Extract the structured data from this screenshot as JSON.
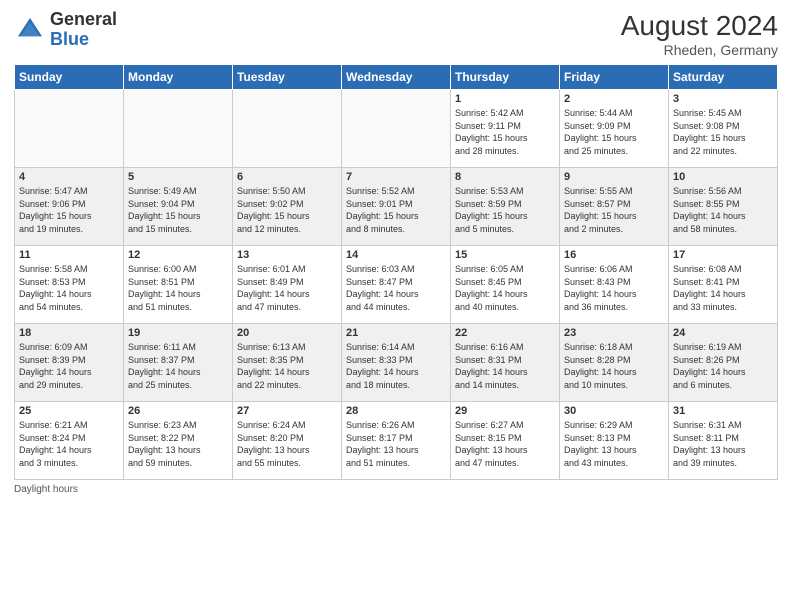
{
  "header": {
    "logo_general": "General",
    "logo_blue": "Blue",
    "month_year": "August 2024",
    "location": "Rheden, Germany"
  },
  "days_of_week": [
    "Sunday",
    "Monday",
    "Tuesday",
    "Wednesday",
    "Thursday",
    "Friday",
    "Saturday"
  ],
  "weeks": [
    [
      {
        "day": "",
        "info": ""
      },
      {
        "day": "",
        "info": ""
      },
      {
        "day": "",
        "info": ""
      },
      {
        "day": "",
        "info": ""
      },
      {
        "day": "1",
        "info": "Sunrise: 5:42 AM\nSunset: 9:11 PM\nDaylight: 15 hours\nand 28 minutes."
      },
      {
        "day": "2",
        "info": "Sunrise: 5:44 AM\nSunset: 9:09 PM\nDaylight: 15 hours\nand 25 minutes."
      },
      {
        "day": "3",
        "info": "Sunrise: 5:45 AM\nSunset: 9:08 PM\nDaylight: 15 hours\nand 22 minutes."
      }
    ],
    [
      {
        "day": "4",
        "info": "Sunrise: 5:47 AM\nSunset: 9:06 PM\nDaylight: 15 hours\nand 19 minutes."
      },
      {
        "day": "5",
        "info": "Sunrise: 5:49 AM\nSunset: 9:04 PM\nDaylight: 15 hours\nand 15 minutes."
      },
      {
        "day": "6",
        "info": "Sunrise: 5:50 AM\nSunset: 9:02 PM\nDaylight: 15 hours\nand 12 minutes."
      },
      {
        "day": "7",
        "info": "Sunrise: 5:52 AM\nSunset: 9:01 PM\nDaylight: 15 hours\nand 8 minutes."
      },
      {
        "day": "8",
        "info": "Sunrise: 5:53 AM\nSunset: 8:59 PM\nDaylight: 15 hours\nand 5 minutes."
      },
      {
        "day": "9",
        "info": "Sunrise: 5:55 AM\nSunset: 8:57 PM\nDaylight: 15 hours\nand 2 minutes."
      },
      {
        "day": "10",
        "info": "Sunrise: 5:56 AM\nSunset: 8:55 PM\nDaylight: 14 hours\nand 58 minutes."
      }
    ],
    [
      {
        "day": "11",
        "info": "Sunrise: 5:58 AM\nSunset: 8:53 PM\nDaylight: 14 hours\nand 54 minutes."
      },
      {
        "day": "12",
        "info": "Sunrise: 6:00 AM\nSunset: 8:51 PM\nDaylight: 14 hours\nand 51 minutes."
      },
      {
        "day": "13",
        "info": "Sunrise: 6:01 AM\nSunset: 8:49 PM\nDaylight: 14 hours\nand 47 minutes."
      },
      {
        "day": "14",
        "info": "Sunrise: 6:03 AM\nSunset: 8:47 PM\nDaylight: 14 hours\nand 44 minutes."
      },
      {
        "day": "15",
        "info": "Sunrise: 6:05 AM\nSunset: 8:45 PM\nDaylight: 14 hours\nand 40 minutes."
      },
      {
        "day": "16",
        "info": "Sunrise: 6:06 AM\nSunset: 8:43 PM\nDaylight: 14 hours\nand 36 minutes."
      },
      {
        "day": "17",
        "info": "Sunrise: 6:08 AM\nSunset: 8:41 PM\nDaylight: 14 hours\nand 33 minutes."
      }
    ],
    [
      {
        "day": "18",
        "info": "Sunrise: 6:09 AM\nSunset: 8:39 PM\nDaylight: 14 hours\nand 29 minutes."
      },
      {
        "day": "19",
        "info": "Sunrise: 6:11 AM\nSunset: 8:37 PM\nDaylight: 14 hours\nand 25 minutes."
      },
      {
        "day": "20",
        "info": "Sunrise: 6:13 AM\nSunset: 8:35 PM\nDaylight: 14 hours\nand 22 minutes."
      },
      {
        "day": "21",
        "info": "Sunrise: 6:14 AM\nSunset: 8:33 PM\nDaylight: 14 hours\nand 18 minutes."
      },
      {
        "day": "22",
        "info": "Sunrise: 6:16 AM\nSunset: 8:31 PM\nDaylight: 14 hours\nand 14 minutes."
      },
      {
        "day": "23",
        "info": "Sunrise: 6:18 AM\nSunset: 8:28 PM\nDaylight: 14 hours\nand 10 minutes."
      },
      {
        "day": "24",
        "info": "Sunrise: 6:19 AM\nSunset: 8:26 PM\nDaylight: 14 hours\nand 6 minutes."
      }
    ],
    [
      {
        "day": "25",
        "info": "Sunrise: 6:21 AM\nSunset: 8:24 PM\nDaylight: 14 hours\nand 3 minutes."
      },
      {
        "day": "26",
        "info": "Sunrise: 6:23 AM\nSunset: 8:22 PM\nDaylight: 13 hours\nand 59 minutes."
      },
      {
        "day": "27",
        "info": "Sunrise: 6:24 AM\nSunset: 8:20 PM\nDaylight: 13 hours\nand 55 minutes."
      },
      {
        "day": "28",
        "info": "Sunrise: 6:26 AM\nSunset: 8:17 PM\nDaylight: 13 hours\nand 51 minutes."
      },
      {
        "day": "29",
        "info": "Sunrise: 6:27 AM\nSunset: 8:15 PM\nDaylight: 13 hours\nand 47 minutes."
      },
      {
        "day": "30",
        "info": "Sunrise: 6:29 AM\nSunset: 8:13 PM\nDaylight: 13 hours\nand 43 minutes."
      },
      {
        "day": "31",
        "info": "Sunrise: 6:31 AM\nSunset: 8:11 PM\nDaylight: 13 hours\nand 39 minutes."
      }
    ]
  ],
  "footer": {
    "note": "Daylight hours"
  }
}
